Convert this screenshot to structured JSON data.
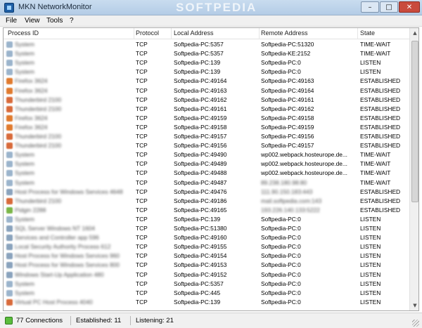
{
  "window": {
    "title": "MKN NetworkMonitor",
    "watermark": "SOFTPEDIA",
    "min_glyph": "–",
    "max_glyph": "□",
    "close_glyph": "✕"
  },
  "menu": [
    "File",
    "View",
    "Tools",
    "?"
  ],
  "columns": {
    "process": "Process ID",
    "protocol": "Protocol",
    "local": "Local Address",
    "remote": "Remote Address",
    "state": "State"
  },
  "rows": [
    {
      "process": "System",
      "protocol": "TCP",
      "local": "Softpedia-PC:5357",
      "remote": "Softpedia-PC:51320",
      "state": "TIME-WAIT",
      "icon_color": "#9bb4cc"
    },
    {
      "process": "System",
      "protocol": "TCP",
      "local": "Softpedia-PC:5357",
      "remote": "Softpedia-KE:2152",
      "state": "TIME-WAIT",
      "icon_color": "#9bb4cc"
    },
    {
      "process": "System",
      "protocol": "TCP",
      "local": "Softpedia-PC:139",
      "remote": "Softpedia-PC:0",
      "state": "LISTEN",
      "icon_color": "#9bb4cc"
    },
    {
      "process": "System",
      "protocol": "TCP",
      "local": "Softpedia-PC:139",
      "remote": "Softpedia-PC:0",
      "state": "LISTEN",
      "icon_color": "#9bb4cc"
    },
    {
      "process": "Firefox 3624",
      "protocol": "TCP",
      "local": "Softpedia-PC:49164",
      "remote": "Softpedia-PC:49163",
      "state": "ESTABLISHED",
      "icon_color": "#e07a2e"
    },
    {
      "process": "Firefox 3624",
      "protocol": "TCP",
      "local": "Softpedia-PC:49163",
      "remote": "Softpedia-PC:49164",
      "state": "ESTABLISHED",
      "icon_color": "#e07a2e"
    },
    {
      "process": "Thunderbird 2100",
      "protocol": "TCP",
      "local": "Softpedia-PC:49162",
      "remote": "Softpedia-PC:49161",
      "state": "ESTABLISHED",
      "icon_color": "#d86a3a"
    },
    {
      "process": "Thunderbird 2100",
      "protocol": "TCP",
      "local": "Softpedia-PC:49161",
      "remote": "Softpedia-PC:49162",
      "state": "ESTABLISHED",
      "icon_color": "#d86a3a"
    },
    {
      "process": "Firefox 3624",
      "protocol": "TCP",
      "local": "Softpedia-PC:49159",
      "remote": "Softpedia-PC:49158",
      "state": "ESTABLISHED",
      "icon_color": "#e07a2e"
    },
    {
      "process": "Firefox 3624",
      "protocol": "TCP",
      "local": "Softpedia-PC:49158",
      "remote": "Softpedia-PC:49159",
      "state": "ESTABLISHED",
      "icon_color": "#e07a2e"
    },
    {
      "process": "Thunderbird 2100",
      "protocol": "TCP",
      "local": "Softpedia-PC:49157",
      "remote": "Softpedia-PC:49156",
      "state": "ESTABLISHED",
      "icon_color": "#d86a3a"
    },
    {
      "process": "Thunderbird 2100",
      "protocol": "TCP",
      "local": "Softpedia-PC:49156",
      "remote": "Softpedia-PC:49157",
      "state": "ESTABLISHED",
      "icon_color": "#d86a3a"
    },
    {
      "process": "System",
      "protocol": "TCP",
      "local": "Softpedia-PC:49490",
      "remote": "wp002.webpack.hosteurope.de...",
      "state": "TIME-WAIT",
      "icon_color": "#9bb4cc"
    },
    {
      "process": "System",
      "protocol": "TCP",
      "local": "Softpedia-PC:49489",
      "remote": "wp002.webpack.hosteurope.de...",
      "state": "TIME-WAIT",
      "icon_color": "#9bb4cc"
    },
    {
      "process": "System",
      "protocol": "TCP",
      "local": "Softpedia-PC:49488",
      "remote": "wp002.webpack.hosteurope.de...",
      "state": "TIME-WAIT",
      "icon_color": "#9bb4cc"
    },
    {
      "process": "System",
      "protocol": "TCP",
      "local": "Softpedia-PC:49487",
      "remote": "89.238.180.98:80",
      "state": "TIME-WAIT",
      "icon_color": "#9bb4cc"
    },
    {
      "process": "Host Process for Windows Services 4648",
      "protocol": "TCP",
      "local": "Softpedia-PC:49476",
      "remote": "111.90.150.183:443",
      "state": "ESTABLISHED",
      "icon_color": "#8aa3bd"
    },
    {
      "process": "Thunderbird 2100",
      "protocol": "TCP",
      "local": "Softpedia-PC:49186",
      "remote": "mail.softpedia.com:143",
      "state": "ESTABLISHED",
      "icon_color": "#d86a3a"
    },
    {
      "process": "Pidgin 2288",
      "protocol": "TCP",
      "local": "Softpedia-PC:49165",
      "remote": "193.226.140.133:5222",
      "state": "ESTABLISHED",
      "icon_color": "#7ab648"
    },
    {
      "process": "System",
      "protocol": "TCP",
      "local": "Softpedia-PC:139",
      "remote": "Softpedia-PC:0",
      "state": "LISTEN",
      "icon_color": "#9bb4cc"
    },
    {
      "process": "SQL Server Windows NT 1604",
      "protocol": "TCP",
      "local": "Softpedia-PC:51380",
      "remote": "Softpedia-PC:0",
      "state": "LISTEN",
      "icon_color": "#8aa3bd"
    },
    {
      "process": "Services and Controller app 596",
      "protocol": "TCP",
      "local": "Softpedia-PC:49160",
      "remote": "Softpedia-PC:0",
      "state": "LISTEN",
      "icon_color": "#8aa3bd"
    },
    {
      "process": "Local Security Authority Process 612",
      "protocol": "TCP",
      "local": "Softpedia-PC:49155",
      "remote": "Softpedia-PC:0",
      "state": "LISTEN",
      "icon_color": "#8aa3bd"
    },
    {
      "process": "Host Process for Windows Services 960",
      "protocol": "TCP",
      "local": "Softpedia-PC:49154",
      "remote": "Softpedia-PC:0",
      "state": "LISTEN",
      "icon_color": "#8aa3bd"
    },
    {
      "process": "Host Process for Windows Services 800",
      "protocol": "TCP",
      "local": "Softpedia-PC:49153",
      "remote": "Softpedia-PC:0",
      "state": "LISTEN",
      "icon_color": "#8aa3bd"
    },
    {
      "process": "Windows Start-Up Application 480",
      "protocol": "TCP",
      "local": "Softpedia-PC:49152",
      "remote": "Softpedia-PC:0",
      "state": "LISTEN",
      "icon_color": "#8aa3bd"
    },
    {
      "process": "System",
      "protocol": "TCP",
      "local": "Softpedia-PC:5357",
      "remote": "Softpedia-PC:0",
      "state": "LISTEN",
      "icon_color": "#9bb4cc"
    },
    {
      "process": "System",
      "protocol": "TCP",
      "local": "Softpedia-PC:445",
      "remote": "Softpedia-PC:0",
      "state": "LISTEN",
      "icon_color": "#9bb4cc"
    },
    {
      "process": "Virtual PC Host Process 4040",
      "protocol": "TCP",
      "local": "Softpedia-PC:139",
      "remote": "Softpedia-PC:0",
      "state": "LISTEN",
      "icon_color": "#d86a3a"
    }
  ],
  "blurred_remote": [
    15,
    16,
    17,
    18
  ],
  "status": {
    "connections": "77 Connections",
    "established": "Established: 11",
    "listening": "Listening: 21"
  },
  "scroll": {
    "up": "▲",
    "down": "▼"
  }
}
